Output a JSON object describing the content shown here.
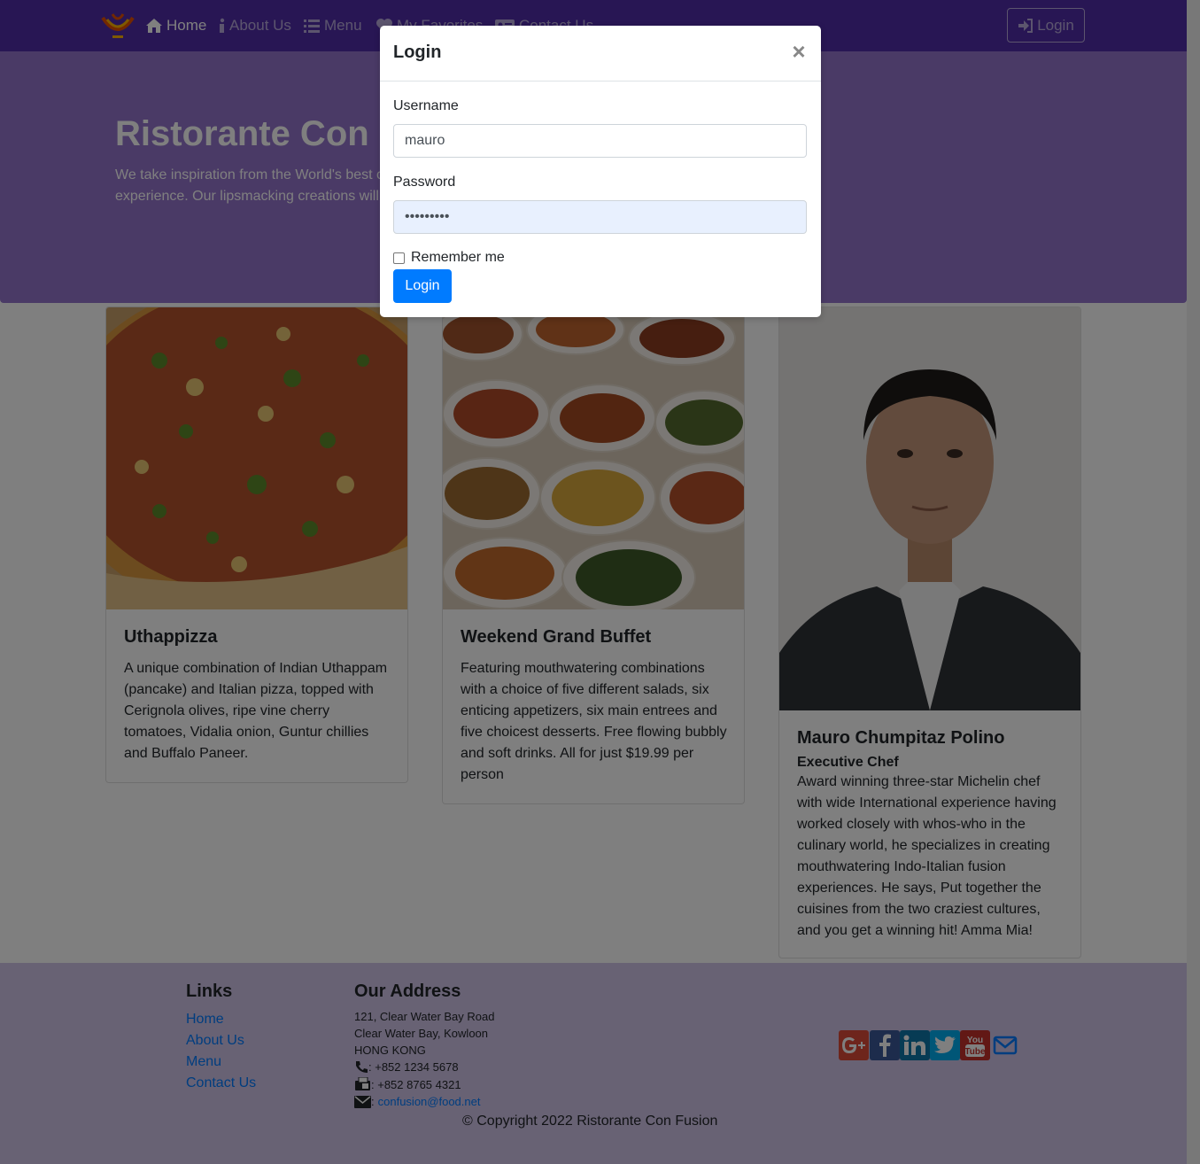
{
  "colors": {
    "navbar": "#512da8",
    "jumbotron": "#9575cd",
    "footer": "#d1c4e9",
    "primary": "#007bff",
    "autofill": "#e8f0fe"
  },
  "navbar": {
    "logo_icon": "ristorante-logo",
    "items": [
      {
        "label": "Home",
        "icon": "home-icon",
        "active": true
      },
      {
        "label": "About Us",
        "icon": "info-icon"
      },
      {
        "label": "Menu",
        "icon": "list-icon"
      },
      {
        "label": "My Favorites",
        "icon": "heart-icon"
      },
      {
        "label": "Contact Us",
        "icon": "address-card-icon"
      }
    ],
    "login_label": "Login",
    "login_icon": "sign-in-icon"
  },
  "jumbotron": {
    "title": "Ristorante Con Fusion",
    "text": "We take inspiration from the World's best cuisines, and create a unique fusion experience. Our lipsmacking creations will tickle your culinary senses!"
  },
  "cards": [
    {
      "image_label": "pizza-photo",
      "title": "Uthappizza",
      "text": "A unique combination of Indian Uthappam (pancake) and Italian pizza, topped with Cerignola olives, ripe vine cherry tomatoes, Vidalia onion, Guntur chillies and Buffalo Paneer."
    },
    {
      "image_label": "buffet-photo",
      "title": "Weekend Grand Buffet",
      "text": "Featuring mouthwatering combinations with a choice of five different salads, six enticing appetizers, six main entrees and five choicest desserts. Free flowing bubbly and soft drinks. All for just $19.99 per person"
    },
    {
      "image_label": "chef-photo",
      "title": "Mauro Chumpitaz Polino",
      "subtitle": "Executive Chef",
      "text": "Award winning three-star Michelin chef with wide International experience having worked closely with whos-who in the culinary world, he specializes in creating mouthwatering Indo-Italian fusion experiences. He says, Put together the cuisines from the two craziest cultures, and you get a winning hit! Amma Mia!"
    }
  ],
  "footer": {
    "links_heading": "Links",
    "links": [
      "Home",
      "About Us",
      "Menu",
      "Contact Us"
    ],
    "address_heading": "Our Address",
    "address_lines": [
      "121, Clear Water Bay Road",
      "Clear Water Bay, Kowloon",
      "HONG KONG"
    ],
    "phone": ": +852 1234 5678",
    "fax": ": +852 8765 4321",
    "email_prefix": ":",
    "email": "confusion@food.net",
    "social": [
      "google-plus-icon",
      "facebook-icon",
      "linkedin-icon",
      "twitter-icon",
      "youtube-icon",
      "envelope-icon"
    ],
    "copyright": "© Copyright 2022 Ristorante Con Fusion"
  },
  "modal": {
    "title": "Login",
    "close_label": "×",
    "username_label": "Username",
    "username_value": "mauro",
    "password_label": "Password",
    "password_value": "•••••••••",
    "remember_label": "Remember me",
    "submit_label": "Login"
  }
}
